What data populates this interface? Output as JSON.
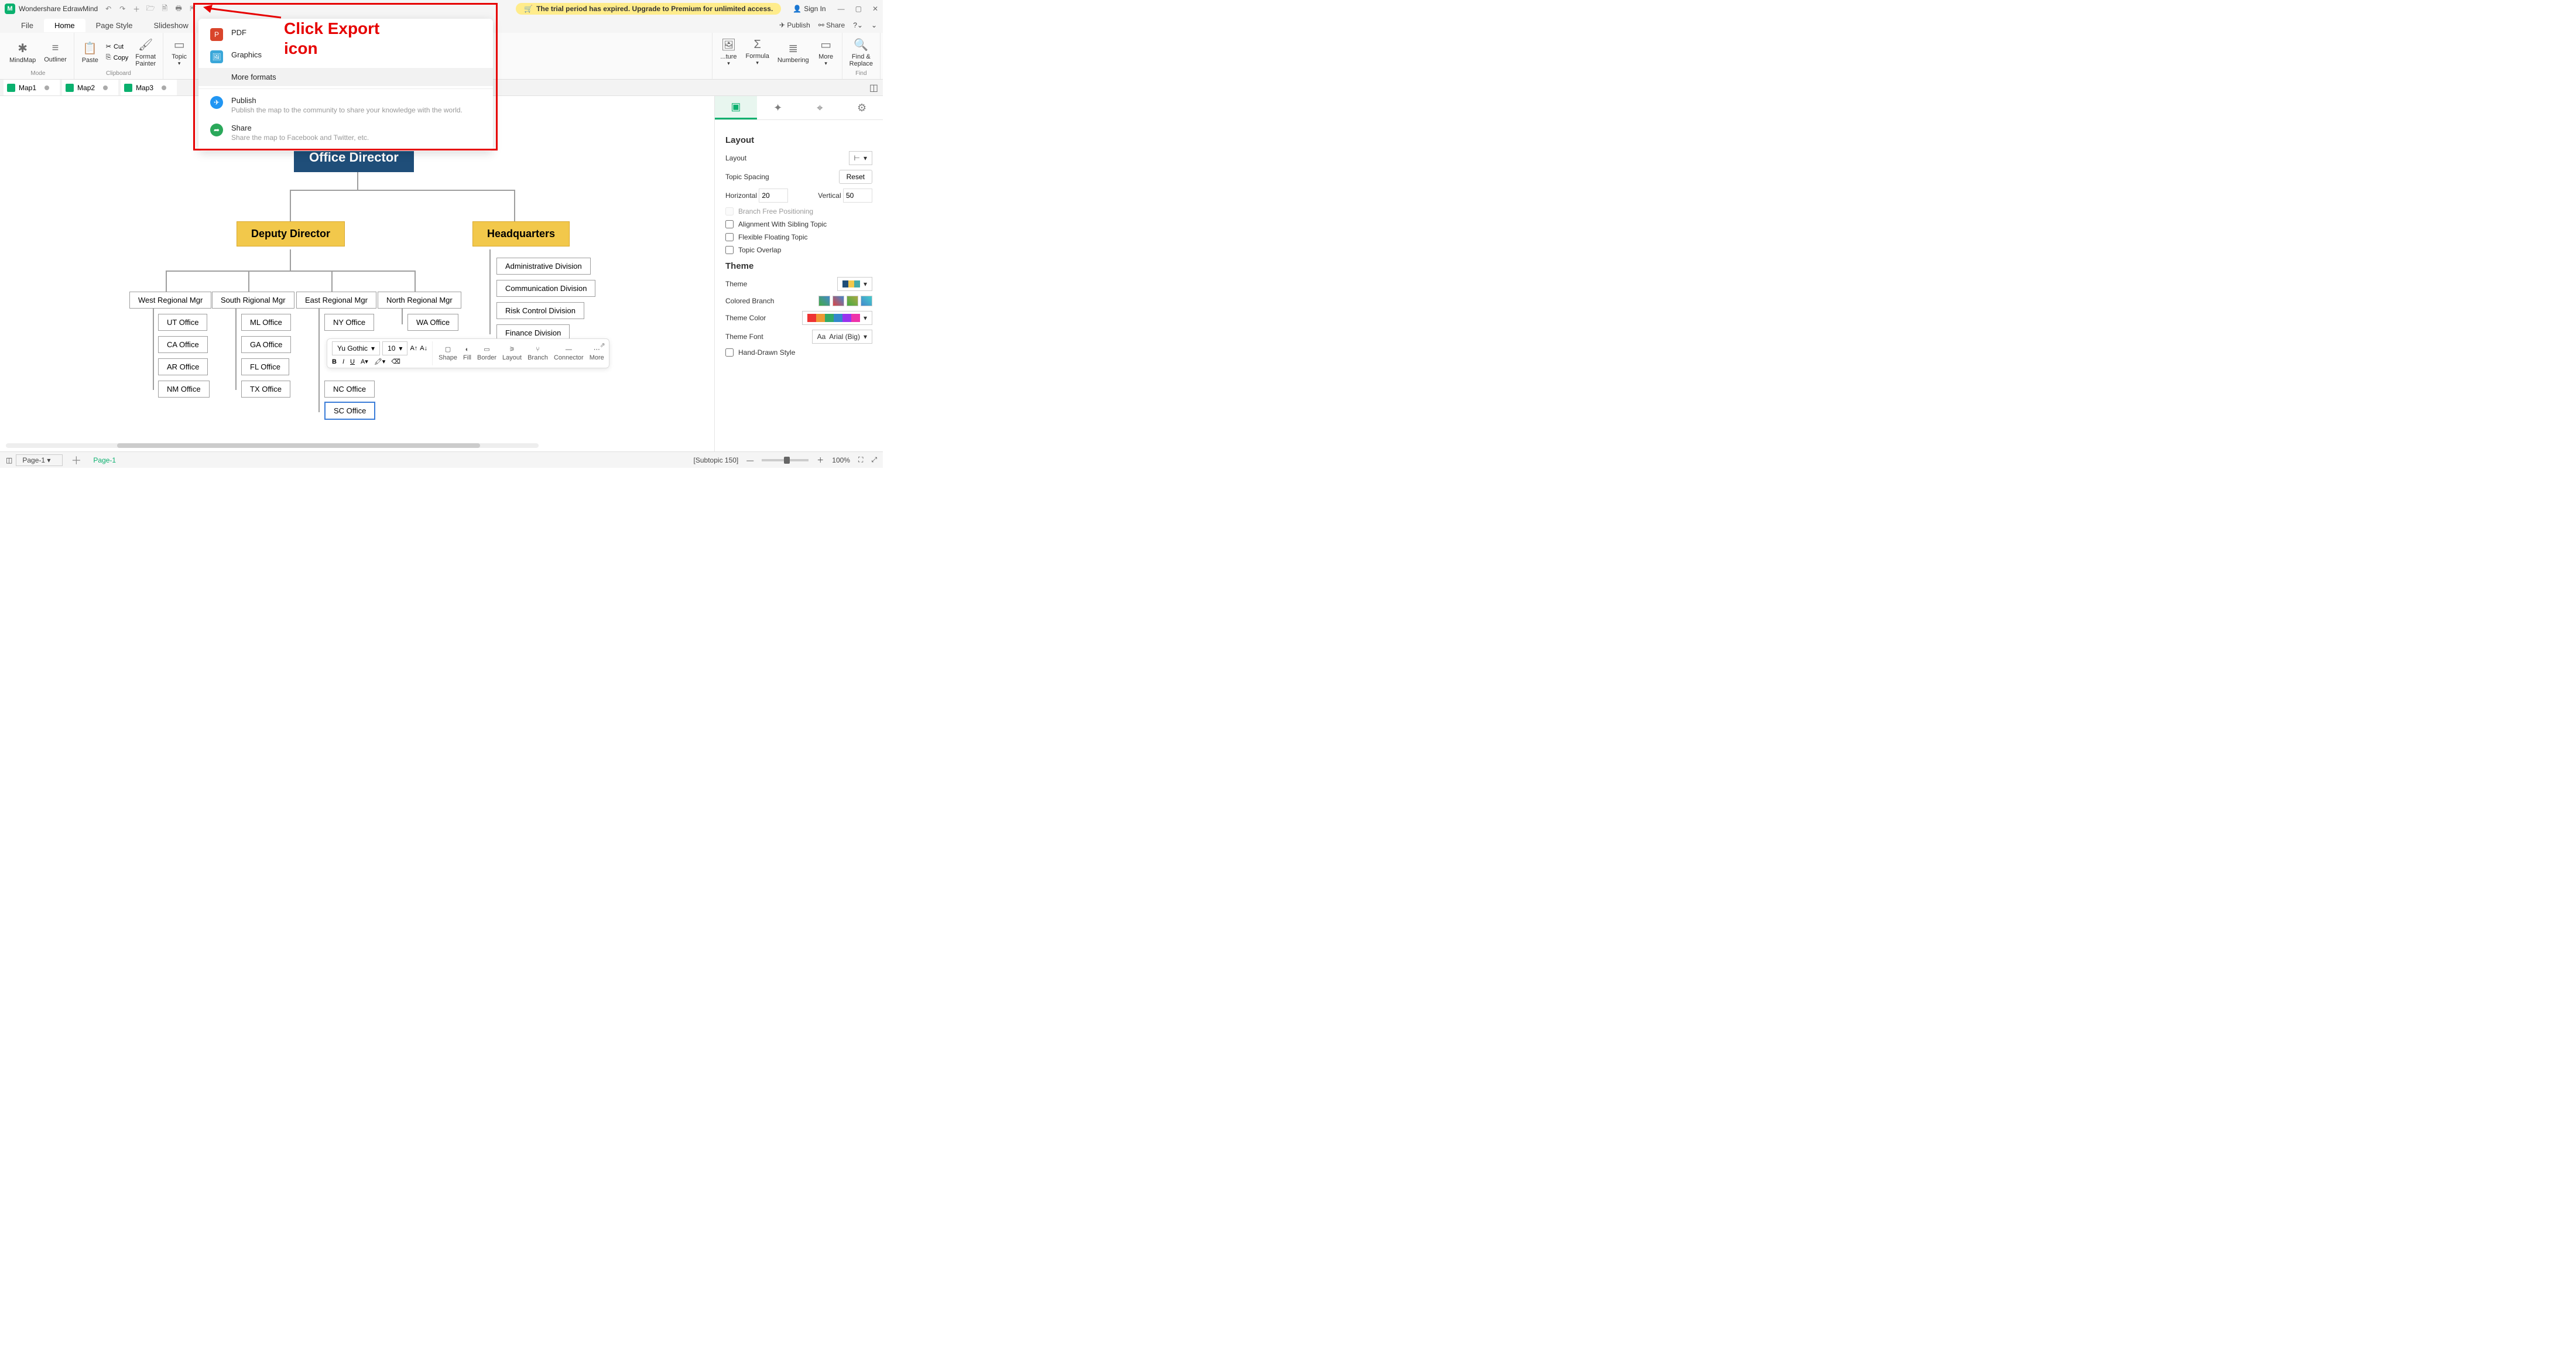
{
  "app_title": "Wondershare EdrawMind",
  "trial_banner": "The trial period has expired. Upgrade to Premium for unlimited access.",
  "sign_in": "Sign In",
  "top_right": {
    "publish": "Publish",
    "share": "Share"
  },
  "menu_tabs": [
    "File",
    "Home",
    "Page Style",
    "Slideshow"
  ],
  "ribbon": {
    "mode_label": "Mode",
    "mindmap": "MindMap",
    "outliner": "Outliner",
    "clipboard_label": "Clipboard",
    "paste": "Paste",
    "cut": "Cut",
    "copy": "Copy",
    "format_painter": "Format\nPainter",
    "topic": "Topic",
    "picture": "...ture",
    "formula": "Formula",
    "numbering": "Numbering",
    "more": "More",
    "find_replace": "Find &\nReplace",
    "find_label": "Find"
  },
  "doc_tabs": [
    "Map1",
    "Map2",
    "Map3"
  ],
  "export_menu": {
    "pdf": "PDF",
    "graphics": "Graphics",
    "more_formats": "More formats",
    "publish_t": "Publish",
    "publish_s": "Publish the map to the community to share your knowledge with the world.",
    "share_t": "Share",
    "share_s": "Share the map to Facebook and Twitter, etc."
  },
  "annotation": "Click Export icon",
  "org": {
    "root": "Office Director",
    "deputy": "Deputy Director",
    "hq": "Headquarters",
    "mgrs": [
      "West Regional Mgr",
      "South Rigional Mgr",
      "East Regional Mgr",
      "North Regional Mgr"
    ],
    "west": [
      "UT Office",
      "CA Office",
      "AR Office",
      "NM Office"
    ],
    "south": [
      "ML Office",
      "GA Office",
      "FL Office",
      "TX Office"
    ],
    "east_ny": "NY Office",
    "east_nc": "NC Office",
    "east_sc": "SC Office",
    "north_wa": "WA Office",
    "hq_divs": [
      "Administrative Division",
      "Communication Division",
      "Risk Control Division",
      "Finance Division"
    ]
  },
  "float_tb": {
    "font": "Yu Gothic",
    "size": "10",
    "shape": "Shape",
    "fill": "Fill",
    "border": "Border",
    "layout": "Layout",
    "branch": "Branch",
    "connector": "Connector",
    "more": "More"
  },
  "rp": {
    "layout_h": "Layout",
    "layout_l": "Layout",
    "spacing_h": "Topic Spacing",
    "reset": "Reset",
    "horizontal": "Horizontal",
    "h_val": "20",
    "vertical": "Vertical",
    "v_val": "50",
    "branch_free": "Branch Free Positioning",
    "align_sibling": "Alignment With Sibling Topic",
    "flex_float": "Flexible Floating Topic",
    "overlap": "Topic Overlap",
    "theme_h": "Theme",
    "theme_l": "Theme",
    "colored_branch": "Colored Branch",
    "theme_color": "Theme Color",
    "theme_font": "Theme Font",
    "font_val": "Arial (Big)",
    "hand_drawn": "Hand-Drawn Style"
  },
  "status": {
    "page_sel": "Page-1",
    "page_cur": "Page-1",
    "subtopic": "[Subtopic 150]",
    "zoom": "100%"
  }
}
